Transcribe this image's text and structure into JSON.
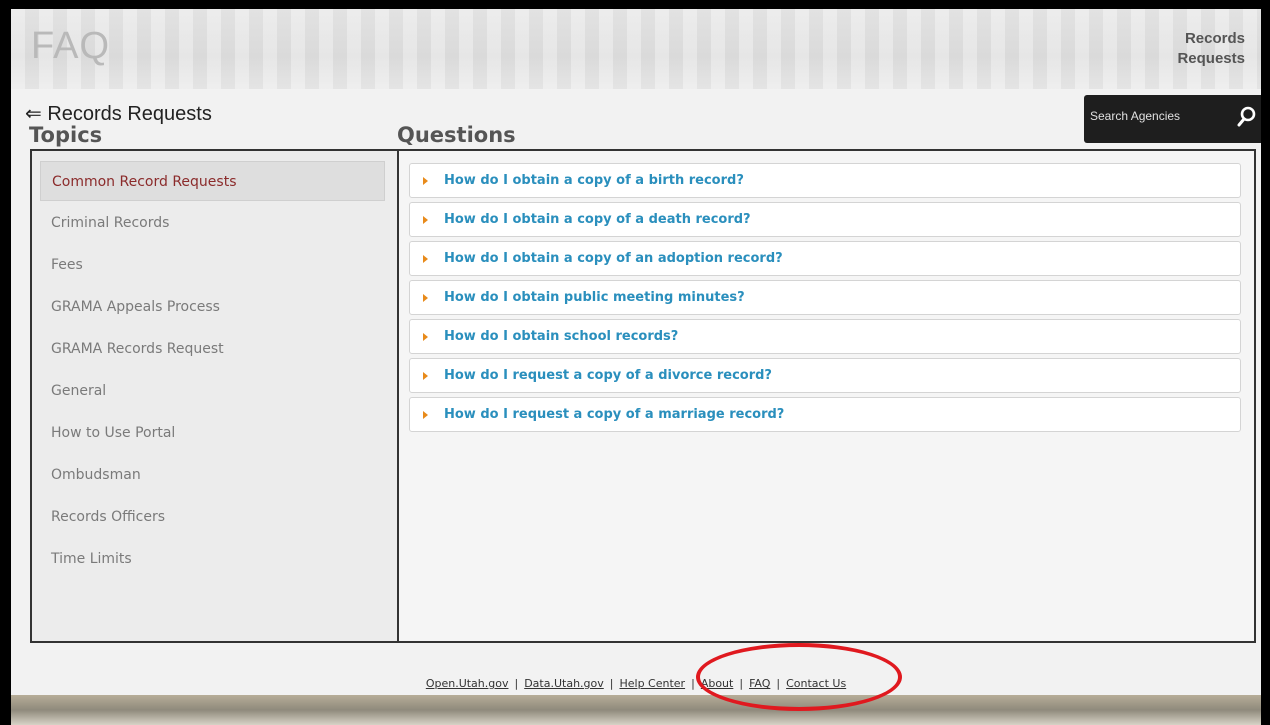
{
  "header": {
    "title": "FAQ",
    "nav_link": "Records Requests"
  },
  "back_link": "⇐ Records Requests",
  "search": {
    "placeholder": "Search Agencies",
    "icon": "search-icon"
  },
  "topics": {
    "heading": "Topics",
    "items": [
      {
        "label": "Common Record Requests",
        "active": true
      },
      {
        "label": "Criminal Records",
        "active": false
      },
      {
        "label": "Fees",
        "active": false
      },
      {
        "label": "GRAMA Appeals Process",
        "active": false
      },
      {
        "label": "GRAMA Records Request",
        "active": false
      },
      {
        "label": "General",
        "active": false
      },
      {
        "label": "How to Use Portal",
        "active": false
      },
      {
        "label": "Ombudsman",
        "active": false
      },
      {
        "label": "Records Officers",
        "active": false
      },
      {
        "label": "Time Limits",
        "active": false
      }
    ]
  },
  "questions": {
    "heading": "Questions",
    "items": [
      "How do I obtain a copy of a birth record?",
      "How do I obtain a copy of a death record?",
      "How do I obtain a copy of an adoption record?",
      "How do I obtain public meeting minutes?",
      "How do I obtain school records?",
      "How do I request a copy of a divorce record?",
      "How do I request a copy of a marriage record?"
    ]
  },
  "footer": {
    "links": [
      "Open.Utah.gov",
      "Data.Utah.gov",
      "Help Center",
      "About",
      "FAQ",
      "Contact Us"
    ],
    "separator": "|"
  },
  "colors": {
    "active_topic": "#8b2b2b",
    "question_link": "#2a8fbd",
    "arrow": "#e88a1a",
    "highlight_ring": "#e0191f"
  }
}
